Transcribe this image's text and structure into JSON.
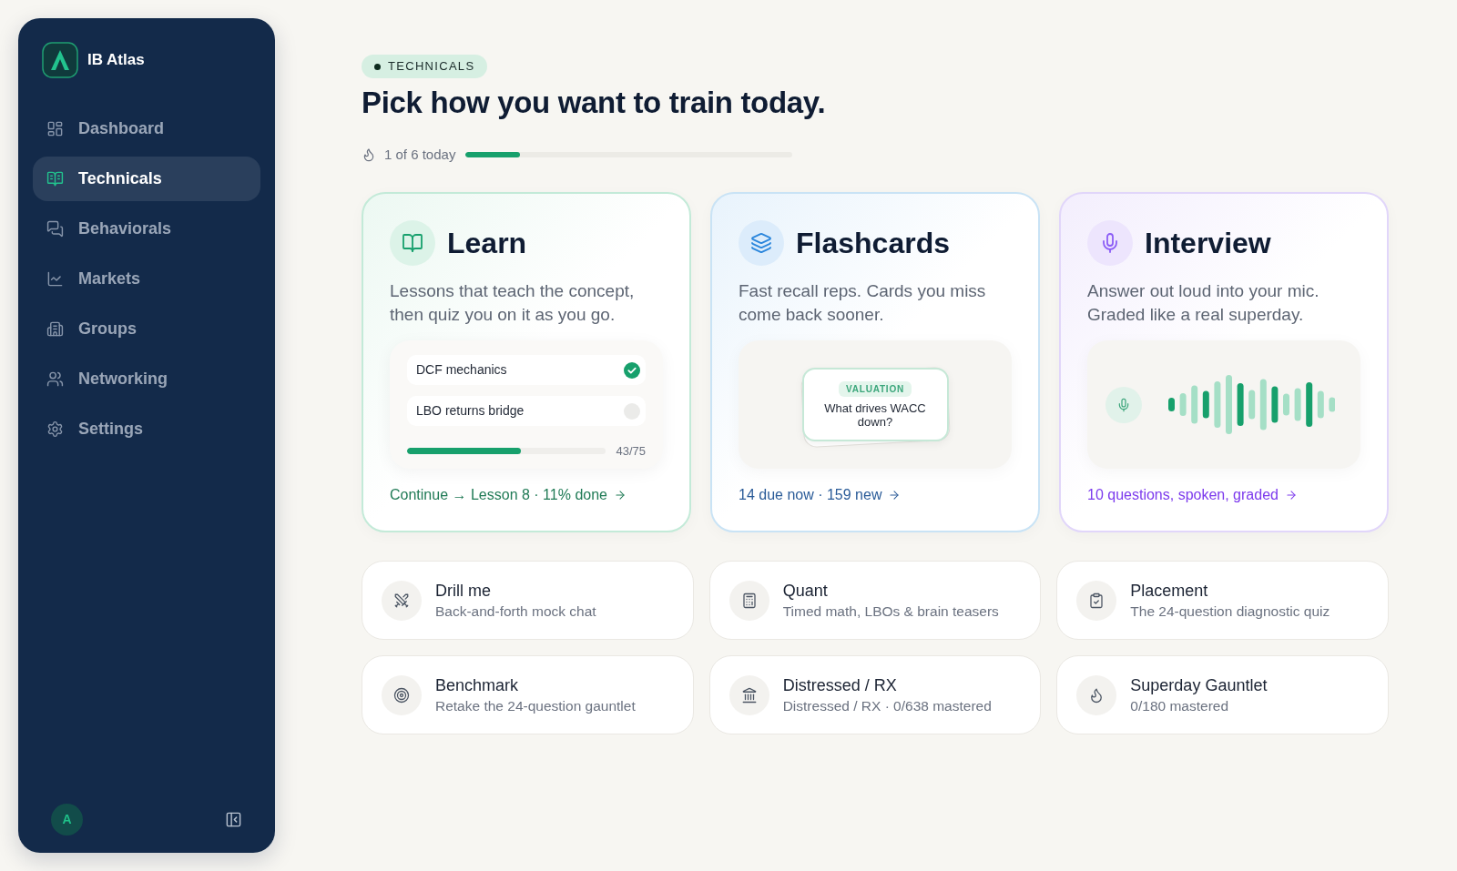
{
  "sidebar": {
    "brand": "IB Atlas",
    "items": [
      {
        "label": "Dashboard",
        "selected": false
      },
      {
        "label": "Technicals",
        "selected": true
      },
      {
        "label": "Behaviorals",
        "selected": false
      },
      {
        "label": "Markets",
        "selected": false
      },
      {
        "label": "Groups",
        "selected": false
      },
      {
        "label": "Networking",
        "selected": false
      },
      {
        "label": "Settings",
        "selected": false
      }
    ],
    "avatar": "A"
  },
  "header": {
    "badge": "TECHNICALS",
    "title": "Pick how you want to train today.",
    "progress": {
      "label": "1 of 6 today",
      "level": 0.167
    }
  },
  "modes": [
    {
      "kind": "learn",
      "title": "Learn",
      "description": "Lessons that teach the concept, then quiz you on it as you go.",
      "lessons": [
        {
          "name": "DCF mechanics",
          "checked": true
        },
        {
          "name": "LBO returns bridge",
          "checked": false
        }
      ],
      "progress": {
        "level": 0.573,
        "reading": "43/75"
      },
      "link": "Continue → Lesson 8 · 11% done"
    },
    {
      "kind": "flashcards",
      "title": "Flashcards",
      "description": "Fast recall reps. Cards you miss come back sooner.",
      "card": {
        "tag": "VALUATION",
        "question": "What drives WACC down?"
      },
      "link": "14 due now · 159 new"
    },
    {
      "kind": "interview",
      "title": "Interview",
      "description": "Answer out loud into your mic. Graded like a real superday.",
      "link": "10 questions, spoken, graded"
    }
  ],
  "drills": [
    {
      "title": "Drill me",
      "subtitle": "Back-and-forth mock chat"
    },
    {
      "title": "Quant",
      "subtitle": "Timed math, LBOs & brain teasers"
    },
    {
      "title": "Placement",
      "subtitle": "The 24-question diagnostic quiz"
    },
    {
      "title": "Benchmark",
      "subtitle": "Retake the 24-question gauntlet"
    },
    {
      "title": "Distressed / RX",
      "subtitle": "Distressed / RX · 0/638 mastered"
    },
    {
      "title": "Superday Gauntlet",
      "subtitle": "0/180 mastered"
    }
  ]
}
